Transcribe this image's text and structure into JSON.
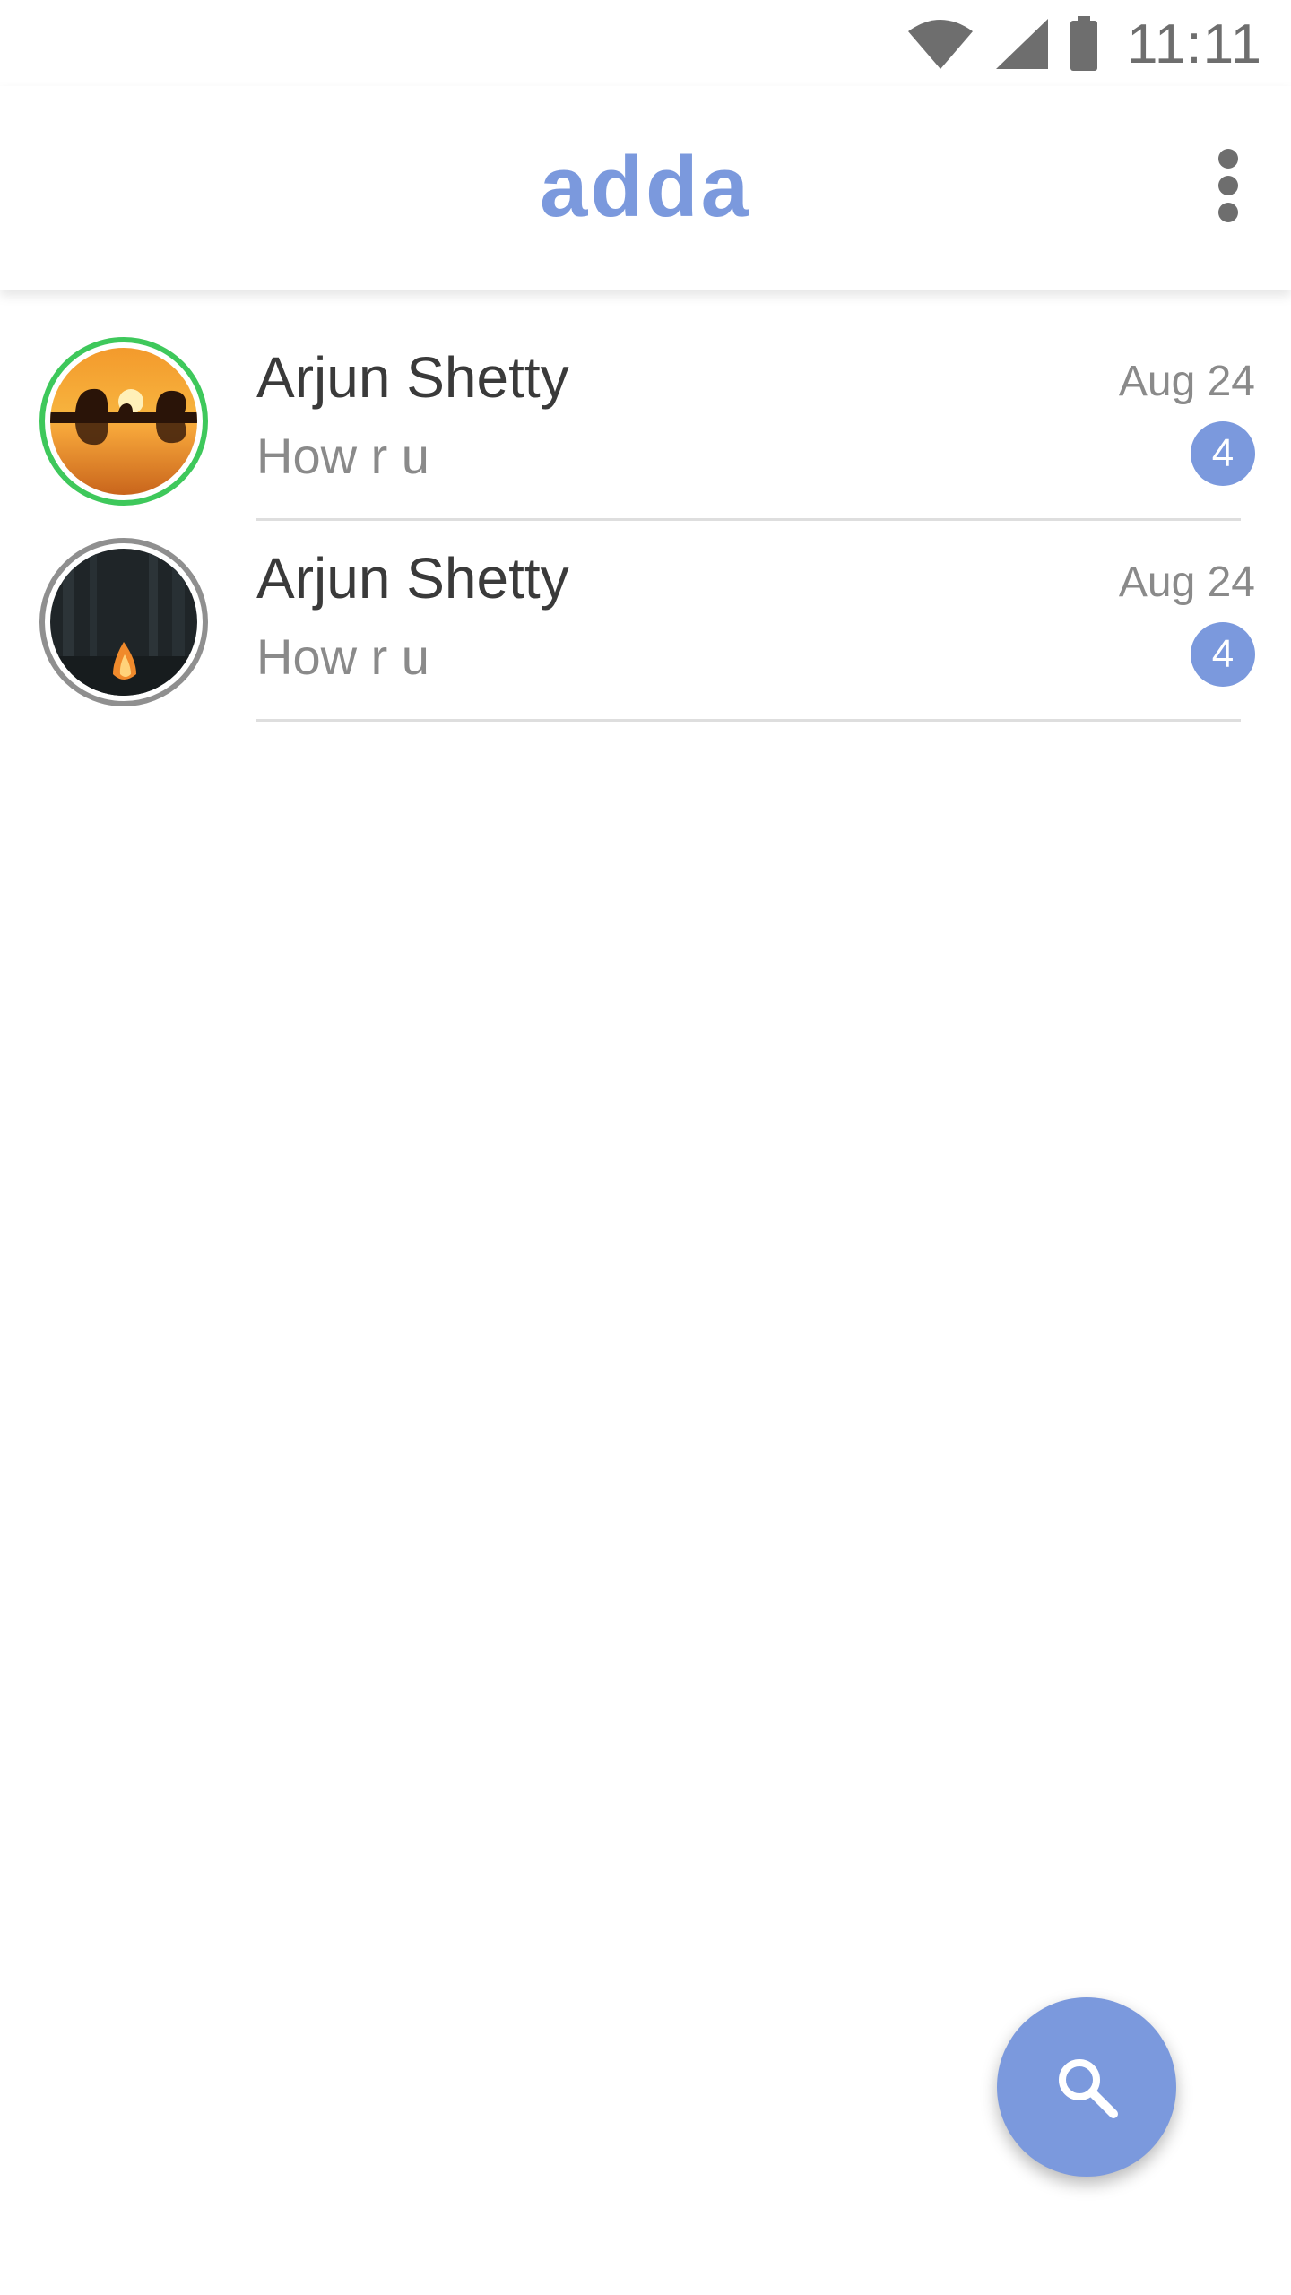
{
  "status_bar": {
    "time": "11:11",
    "icons": [
      "wifi-icon",
      "cellular-signal-icon",
      "battery-icon"
    ]
  },
  "app_bar": {
    "title": "adda",
    "menu_icon": "more-vert-icon"
  },
  "chats": [
    {
      "name": "Arjun Shetty",
      "last_message": "How r u",
      "date": "Aug 24",
      "unread_count": "4",
      "status": "online",
      "avatar": "elephants-sunset-photo"
    },
    {
      "name": "Arjun Shetty",
      "last_message": "How r u",
      "date": "Aug 24",
      "unread_count": "4",
      "status": "offline",
      "avatar": "campfire-forest-photo"
    }
  ],
  "fab": {
    "icon": "search-icon"
  },
  "colors": {
    "accent": "#7b99dd",
    "online_ring": "#3ec85b",
    "offline_ring": "#8f8f8f",
    "text_primary": "#3a3a3a",
    "text_secondary": "#8a8a8a",
    "divider": "#dedede"
  }
}
